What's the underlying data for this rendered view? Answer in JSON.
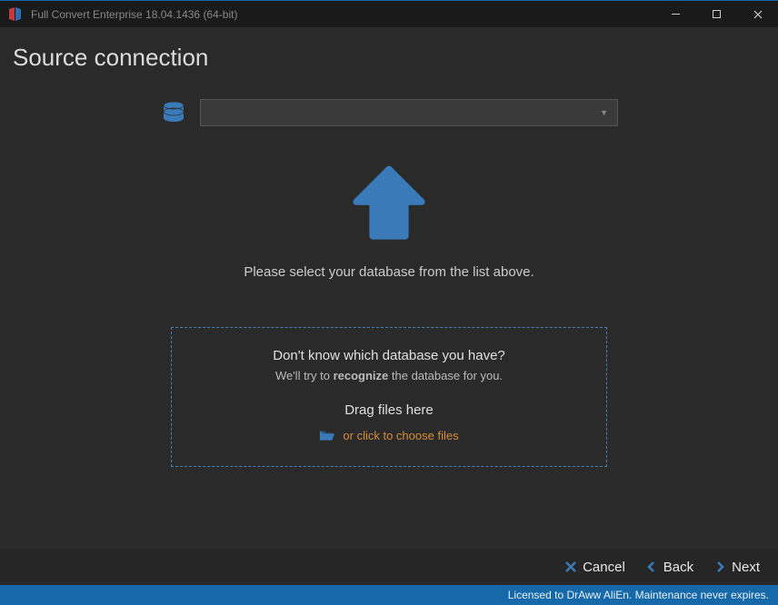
{
  "titlebar": {
    "text": "Full Convert Enterprise 18.04.1436 (64-bit)"
  },
  "header": {
    "title": "Source connection"
  },
  "dropdown": {
    "value": ""
  },
  "instruction": "Please select your database from the list above.",
  "dropzone": {
    "title": "Don't know which database you have?",
    "sub_pre": "We'll try to ",
    "sub_bold": "recognize",
    "sub_post": " the database for you.",
    "drag": "Drag files here",
    "link": "or click to choose files"
  },
  "footer": {
    "cancel": "Cancel",
    "back": "Back",
    "next": "Next"
  },
  "statusbar": {
    "text": "Licensed to DrAww AliEn. Maintenance never expires."
  },
  "colors": {
    "accent": "#3a7ab8",
    "link": "#d68b3a"
  }
}
